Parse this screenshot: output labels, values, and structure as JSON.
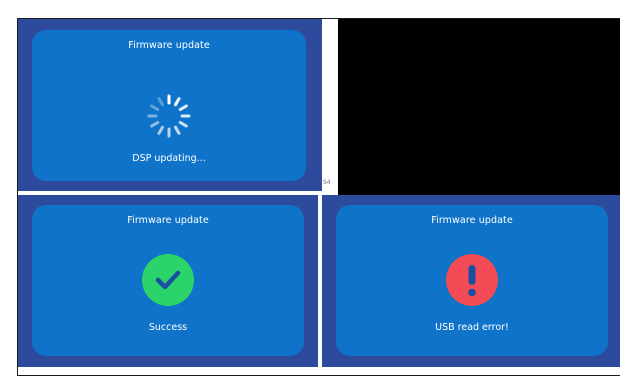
{
  "screens": [
    {
      "state": "updating",
      "title": "Firmware update",
      "status": "DSP updating...",
      "icon": "spinner-icon",
      "corner_label": "S4"
    },
    {
      "state": "success",
      "title": "Firmware update",
      "status": "Success",
      "icon": "checkmark-icon",
      "icon_color": "#2bd46a"
    },
    {
      "state": "error",
      "title": "Firmware update",
      "status": "USB read error!",
      "icon": "exclamation-icon",
      "icon_color": "#f24b55"
    }
  ],
  "colors": {
    "screen_border": "#2e4a9c",
    "panel": "#0f74c9",
    "text": "#ffffff",
    "empty_area": "#000000"
  }
}
